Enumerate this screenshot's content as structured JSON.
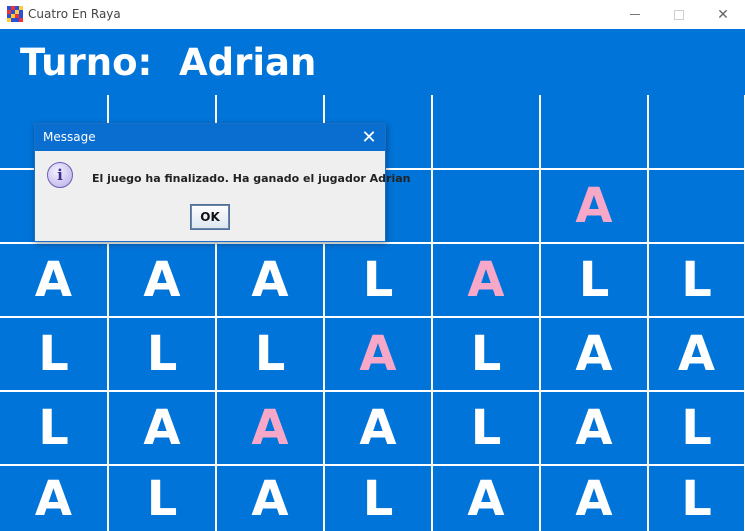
{
  "window": {
    "title": "Cuatro En Raya",
    "minimize_icon": "minimize-icon",
    "maximize_icon": "maximize-icon",
    "close_label": "✕"
  },
  "colors": {
    "board_blue": "#0074d9",
    "piece_white": "#ffffff",
    "winning_pink": "#f7a7c7"
  },
  "header": {
    "turn_label": "Turno:",
    "player_name": "Adrian"
  },
  "board": {
    "rows": [
      [
        "",
        "",
        "",
        "",
        "",
        "",
        ""
      ],
      [
        "",
        "",
        "",
        "",
        "",
        "A",
        ""
      ],
      [
        "A",
        "A",
        "A",
        "L",
        "A",
        "L",
        "L"
      ],
      [
        "L",
        "L",
        "L",
        "A",
        "L",
        "A",
        "A"
      ],
      [
        "L",
        "A",
        "A",
        "A",
        "L",
        "A",
        "L"
      ],
      [
        "A",
        "L",
        "A",
        "L",
        "A",
        "A",
        "L"
      ]
    ],
    "winning_cells": [
      [
        1,
        5
      ],
      [
        2,
        4
      ],
      [
        3,
        3
      ],
      [
        4,
        2
      ]
    ]
  },
  "dialog": {
    "title": "Message",
    "close_label": "✕",
    "icon": "info-icon",
    "icon_glyph": "i",
    "message": "El juego ha finalizado. Ha ganado el jugador Adrian",
    "ok_label": "OK"
  }
}
